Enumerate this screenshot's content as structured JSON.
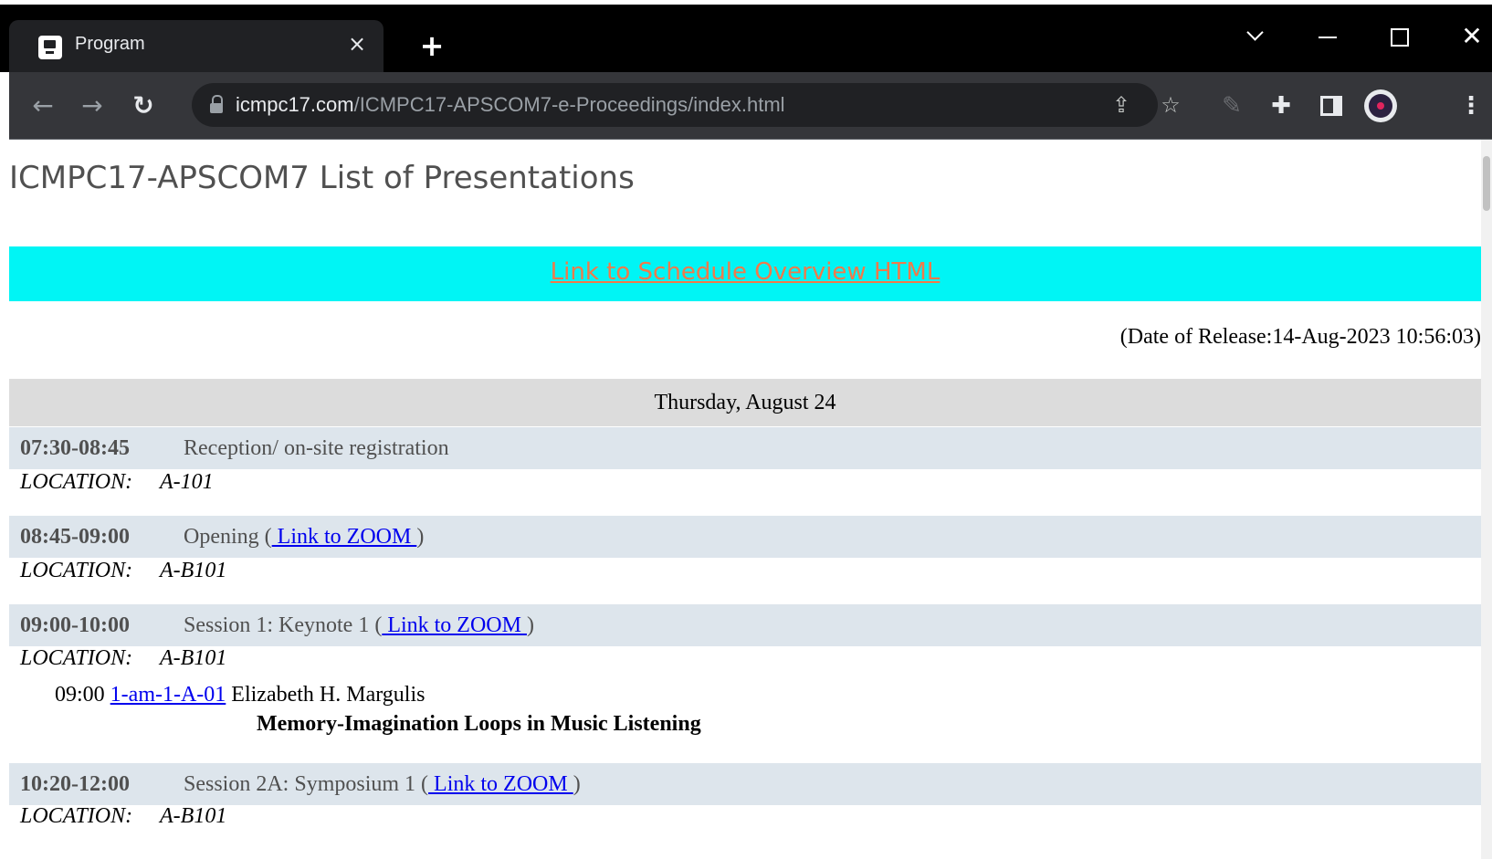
{
  "browser": {
    "tab_title": "Program",
    "tab_close": "×",
    "new_tab": "+",
    "url_host": "icmpc17.com",
    "url_path": "/ICMPC17-APSCOM7-e-Proceedings/index.html",
    "icons": {
      "back": "arrow-left-icon",
      "forward": "arrow-right-icon",
      "reload": "reload-icon",
      "lock": "lock-icon",
      "share": "share-icon",
      "bookmark": "star-icon",
      "extension": "extension-icon",
      "extensions_menu": "puzzle-icon",
      "side_panel": "side-panel-icon",
      "profile": "profile-avatar-icon",
      "menu": "kebab-menu-icon"
    }
  },
  "page": {
    "title": "ICMPC17-APSCOM7 List of Presentations",
    "schedule_link": "Link to Schedule Overview HTML",
    "release": "(Date of Release:14-Aug-2023 10:56:03)",
    "day": "Thursday, August 24",
    "location_label": "LOCATION:",
    "sessions": [
      {
        "time": "07:30-08:45",
        "title": "Reception/ on-site registration",
        "location": "A-101"
      },
      {
        "time": "08:45-09:00",
        "title": "Opening (",
        "zoom_link": " Link to ZOOM ",
        "close": ")",
        "location": "A-B101"
      },
      {
        "time": "09:00-10:00",
        "title": "Session 1: Keynote 1 (",
        "zoom_link": " Link to ZOOM ",
        "close": ")",
        "location": "A-B101",
        "presentations": [
          {
            "time": "09:00",
            "id": "1-am-1-A-01",
            "author": "Elizabeth H. Margulis",
            "title": "Memory-Imagination Loops in Music Listening"
          }
        ]
      },
      {
        "time": "10:20-12:00",
        "title": "Session 2A: Symposium 1 (",
        "zoom_link": " Link to ZOOM ",
        "close": ")",
        "location": "A-B101"
      }
    ]
  },
  "colors": {
    "banner": "#00f5f5",
    "banner_link": "#f07a4a",
    "session_bar": "#dde5ec",
    "day_header": "#dcdcdc",
    "link": "#0000ee"
  }
}
